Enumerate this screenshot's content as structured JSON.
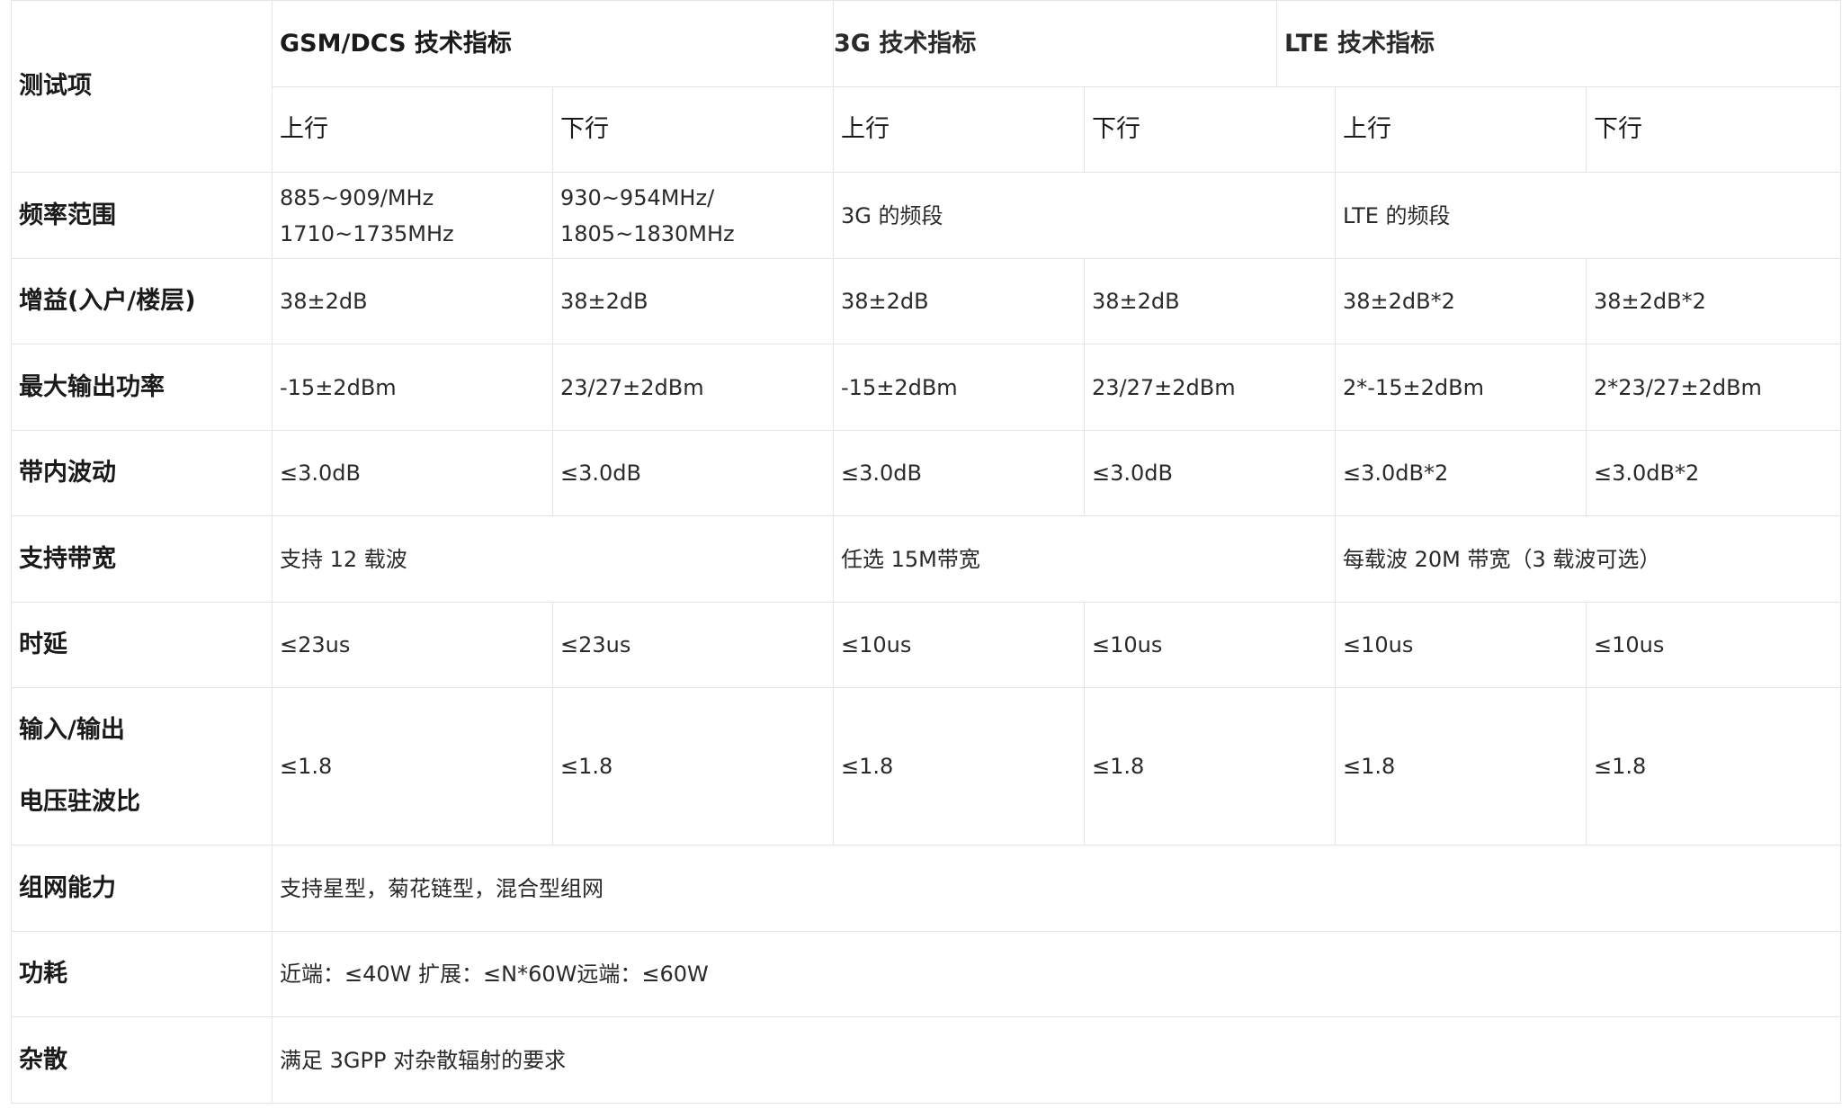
{
  "table": {
    "corner": "测试项",
    "groups": {
      "gsm": "GSM/DCS 技术指标",
      "g3": "3G 技术指标",
      "lte": "LTE 技术指标"
    },
    "sub": {
      "up": "上行",
      "down": "下行"
    },
    "rows": {
      "freq": {
        "label": "频率范围",
        "gsm_up": [
          "885~909/MHz",
          "1710~1735MHz"
        ],
        "gsm_down": [
          "930~954MHz/",
          "1805~1830MHz"
        ],
        "g3": "3G 的频段",
        "lte": "LTE 的频段"
      },
      "gain": {
        "label": "增益(入户/楼层)",
        "cells": [
          "38±2dB",
          "38±2dB",
          "38±2dB",
          "38±2dB",
          "38±2dB*2",
          "38±2dB*2"
        ]
      },
      "power": {
        "label": "最大输出功率",
        "cells": [
          "-15±2dBm",
          "23/27±2dBm",
          "-15±2dBm",
          "23/27±2dBm",
          "2*-15±2dBm",
          "2*23/27±2dBm"
        ]
      },
      "ripple": {
        "label": "带内波动",
        "cells": [
          "≤3.0dB",
          "≤3.0dB",
          "≤3.0dB",
          "≤3.0dB",
          "≤3.0dB*2",
          "≤3.0dB*2"
        ]
      },
      "bandwidth": {
        "label": "支持带宽",
        "gsm": "支持 12 载波",
        "g3": "任选 15M带宽",
        "lte": "每载波 20M 带宽（3 载波可选）"
      },
      "delay": {
        "label": "时延",
        "cells": [
          "≤23us",
          "≤23us",
          "≤10us",
          "≤10us",
          "≤10us",
          "≤10us"
        ]
      },
      "vswr": {
        "label": [
          "输入/输出",
          "电压驻波比"
        ],
        "cells": [
          "≤1.8",
          "≤1.8",
          "≤1.8",
          "≤1.8",
          "≤1.8",
          "≤1.8"
        ]
      },
      "network": {
        "label": "组网能力",
        "value": "支持星型，菊花链型，混合型组网"
      },
      "consumption": {
        "label": "功耗",
        "value": "近端：≤40W 扩展：≤N*60W远端：≤60W"
      },
      "spurious": {
        "label": "杂散",
        "value": "满足 3GPP 对杂散辐射的要求"
      }
    }
  }
}
